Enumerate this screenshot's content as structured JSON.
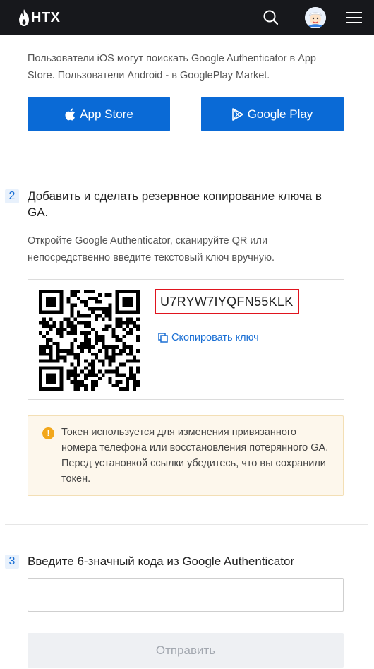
{
  "header": {
    "logo_text": "HTX",
    "icons": [
      "htx-flame-icon",
      "search-icon",
      "avatar",
      "menu-icon"
    ]
  },
  "section_apps": {
    "hint": "Пользователи iOS могут поискать Google Authenticator в App Store. Пользователи Android - в GooglePlay Market.",
    "app_store_label": "App Store",
    "google_play_label": "Google Play"
  },
  "step2": {
    "number": "2",
    "title": "Добавить и сделать резервное копирование ключа в GA.",
    "hint": "Откройте Google Authenticator, сканируйте QR или непосредственно введите текстовый ключ вручную.",
    "secret_key": "U7RYW7IYQFN55KLK",
    "copy_label": "Скопировать ключ",
    "warning": "Токен используется для изменения привязанного номера телефона или восстановления потерянного GA. Перед установкой ссылки убедитесь, что вы сохранили токен."
  },
  "step3": {
    "number": "3",
    "title": "Введите 6-значный кода из Google Authenticator",
    "input_value": "",
    "input_placeholder": "",
    "submit_label": "Отправить"
  },
  "colors": {
    "header_bg": "#17181c",
    "primary": "#0a6ad6",
    "highlight_border": "#e0141e",
    "warning_icon": "#f2a71b"
  }
}
